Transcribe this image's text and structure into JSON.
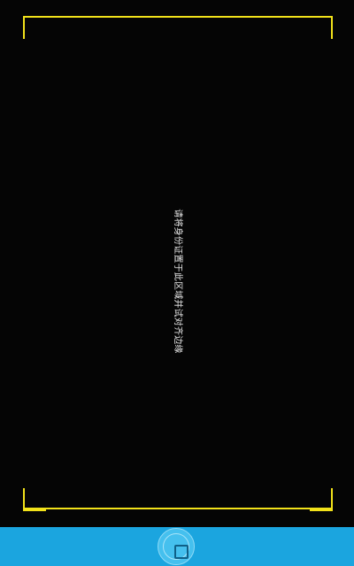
{
  "camera": {
    "hint_text": "请将身份证置于此区域并试对齐边缘",
    "frame_color": "#f2e21a"
  },
  "bottom_bar": {
    "background_color": "#1ba5df",
    "shutter_icon": "shutter-square-icon"
  }
}
